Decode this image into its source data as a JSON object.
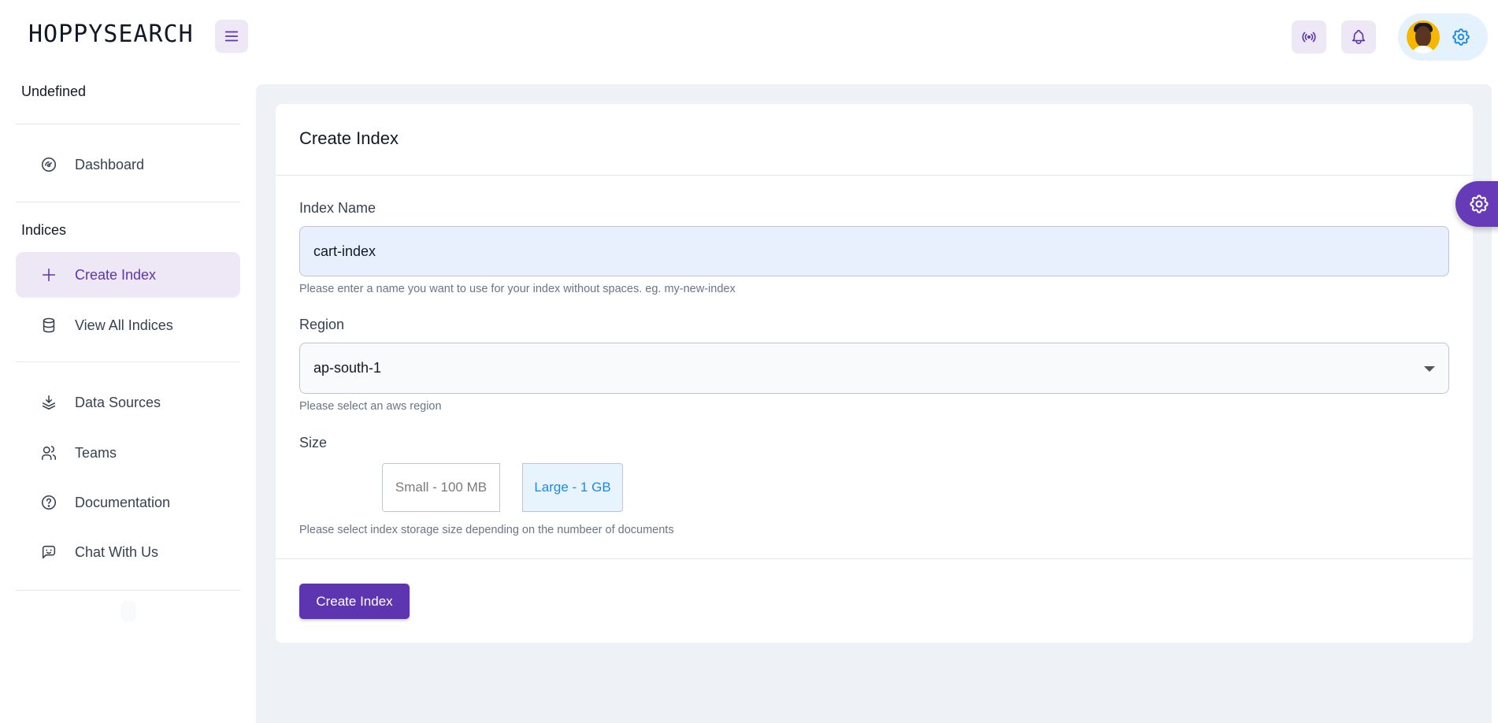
{
  "header": {
    "logo": "HOPPYSEARCH",
    "icons": {
      "menu": "menu-icon",
      "broadcast": "broadcast-icon",
      "bell": "bell-icon",
      "settings": "gear-icon"
    }
  },
  "sidebar": {
    "org_label": "Undefined",
    "dashboard_label": "Dashboard",
    "indices_heading": "Indices",
    "indices_items": [
      {
        "label": "Create Index",
        "icon": "plus-icon",
        "active": true
      },
      {
        "label": "View All Indices",
        "icon": "database-icon",
        "active": false
      }
    ],
    "other_items": [
      {
        "label": "Data Sources",
        "icon": "layers-icon"
      },
      {
        "label": "Teams",
        "icon": "users-icon"
      },
      {
        "label": "Documentation",
        "icon": "help-circle-icon"
      },
      {
        "label": "Chat With Us",
        "icon": "chat-icon"
      }
    ]
  },
  "form": {
    "title": "Create Index",
    "index_name": {
      "label": "Index Name",
      "value": "cart-index",
      "helper": "Please enter a name you want to use for your index without spaces. eg. my-new-index"
    },
    "region": {
      "label": "Region",
      "value": "ap-south-1",
      "helper": "Please select an aws region"
    },
    "size": {
      "label": "Size",
      "options": [
        "Small - 100 MB",
        "Large - 1 GB"
      ],
      "selected": "Large - 1 GB",
      "helper": "Please select index storage size depending on the numbeer of documents"
    },
    "submit_label": "Create Index"
  },
  "colors": {
    "primary": "#5e35b1",
    "primary_light": "#ede7f6",
    "accent_blue": "#1e88e5",
    "background": "#eef2f6"
  }
}
